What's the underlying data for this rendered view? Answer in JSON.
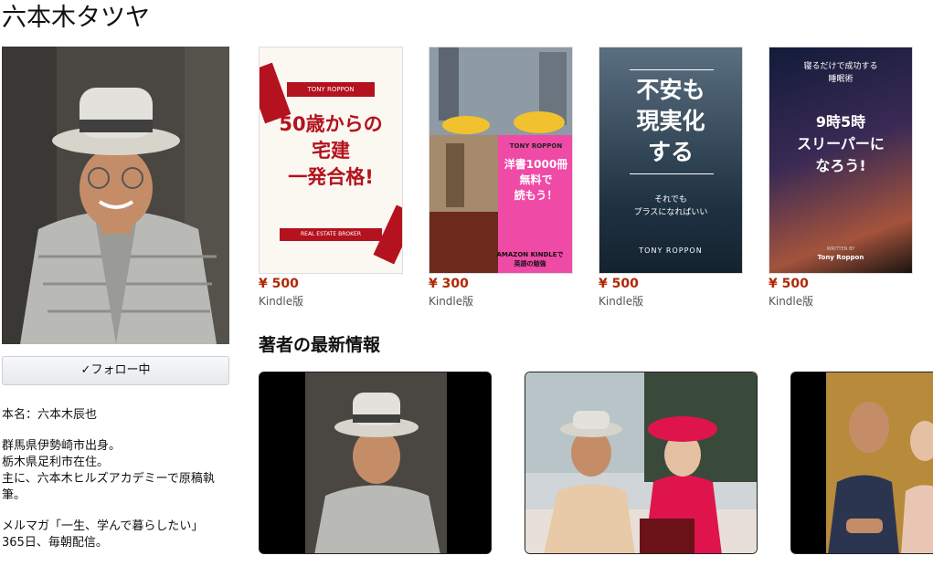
{
  "author": {
    "name": "六本木タツヤ",
    "follow_label": "フォロー中",
    "bio": [
      "本名：六本木辰也",
      "群馬県伊勢崎市出身。\n栃木県足利市在住。\n主に、六本木ヒルズアカデミーで原稿執筆。",
      "メルマガ「一生、学んで暮らしたい」\n365日、毎朝配信。"
    ]
  },
  "books": [
    {
      "cover_author": "TONY ROPPON",
      "cover_title": "50歳からの\n宅建\n一発合格!",
      "cover_footer": "REAL ESTATE BROKER",
      "price": "¥ 500",
      "format": "Kindle版"
    },
    {
      "cover_author": "TONY ROPPON",
      "cover_title": "洋書1000冊\n無料で\n読もう！",
      "cover_footer": "AMAZON KINDLEで\n英語の勉強",
      "price": "¥ 300",
      "format": "Kindle版"
    },
    {
      "cover_title": "不安も\n現実化\nする",
      "cover_subtitle": "それでも\nプラスになればいい",
      "cover_author": "TONY ROPPON",
      "price": "¥ 500",
      "format": "Kindle版"
    },
    {
      "cover_top": "寝るだけで成功する\n睡眠術",
      "cover_title": "9時5時\nスリーパーに\nなろう!",
      "cover_written": "WRITTEN BY",
      "cover_author": "Tony Roppon",
      "price": "¥ 500",
      "format": "Kindle版"
    }
  ],
  "latest": {
    "title": "著者の最新情報"
  },
  "icons": {
    "follow_check": "checkmark-icon"
  },
  "colors": {
    "price": "#b12704",
    "book1_red": "#b3121e",
    "book2_pink": "#ef4aa6"
  }
}
